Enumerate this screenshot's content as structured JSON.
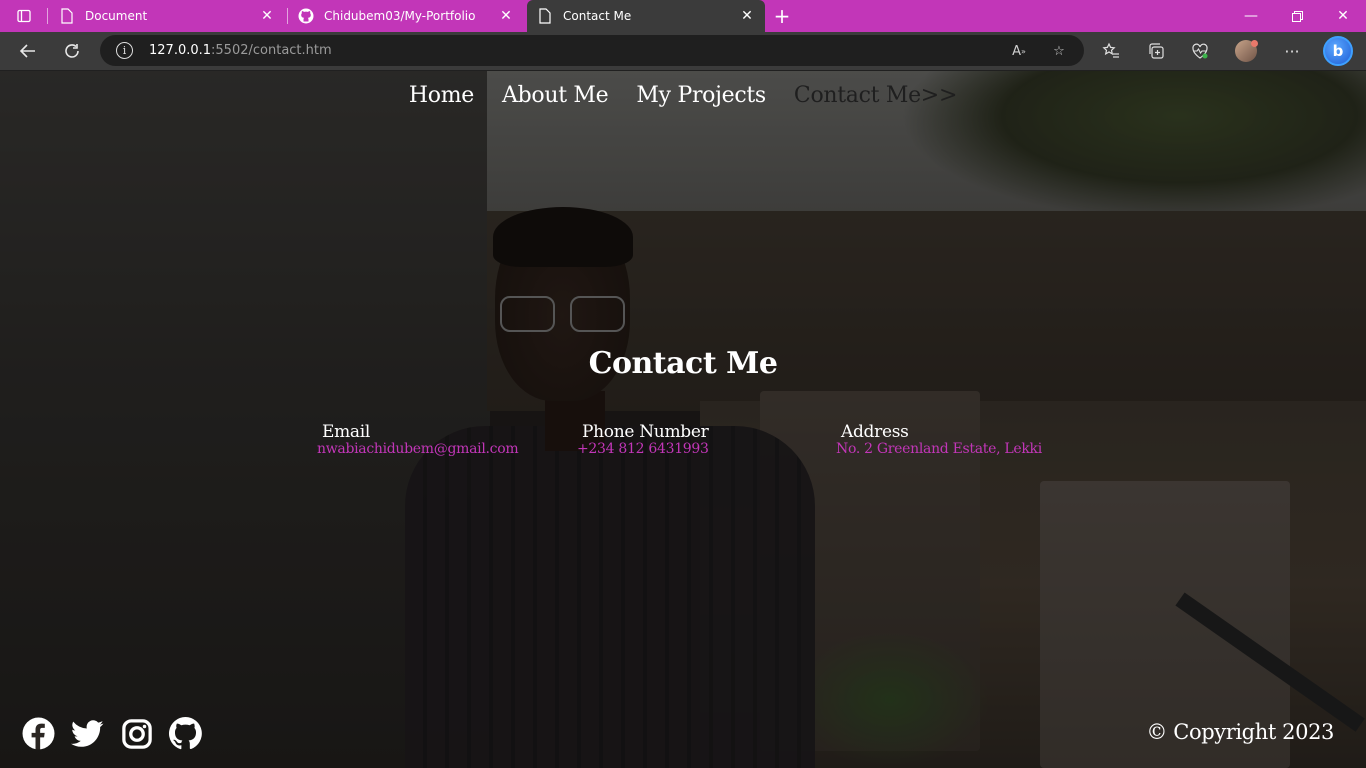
{
  "browser": {
    "tabs": [
      {
        "title": "Document",
        "icon": "page-icon"
      },
      {
        "title": "Chidubem03/My-Portfolio",
        "icon": "github-icon"
      },
      {
        "title": "Contact Me",
        "icon": "page-icon",
        "active": true
      }
    ],
    "url_host": "127.0.0.1",
    "url_rest": ":5502/contact.htm",
    "accent": "#c236b8"
  },
  "nav": {
    "home": "Home",
    "about": "About Me",
    "projects": "My Projects",
    "contact": "Contact Me>>"
  },
  "contact": {
    "title": "Contact Me",
    "email_label": "Email",
    "email_value": "nwabiachidubem@gmail.com",
    "phone_label": "Phone Number",
    "phone_value": "+234 812 6431993",
    "address_label": "Address",
    "address_value": "No. 2 Greenland Estate, Lekki"
  },
  "footer": {
    "socials": [
      "facebook-icon",
      "twitter-icon",
      "instagram-icon",
      "github-icon"
    ],
    "copyright": "© Copyright 2023"
  }
}
